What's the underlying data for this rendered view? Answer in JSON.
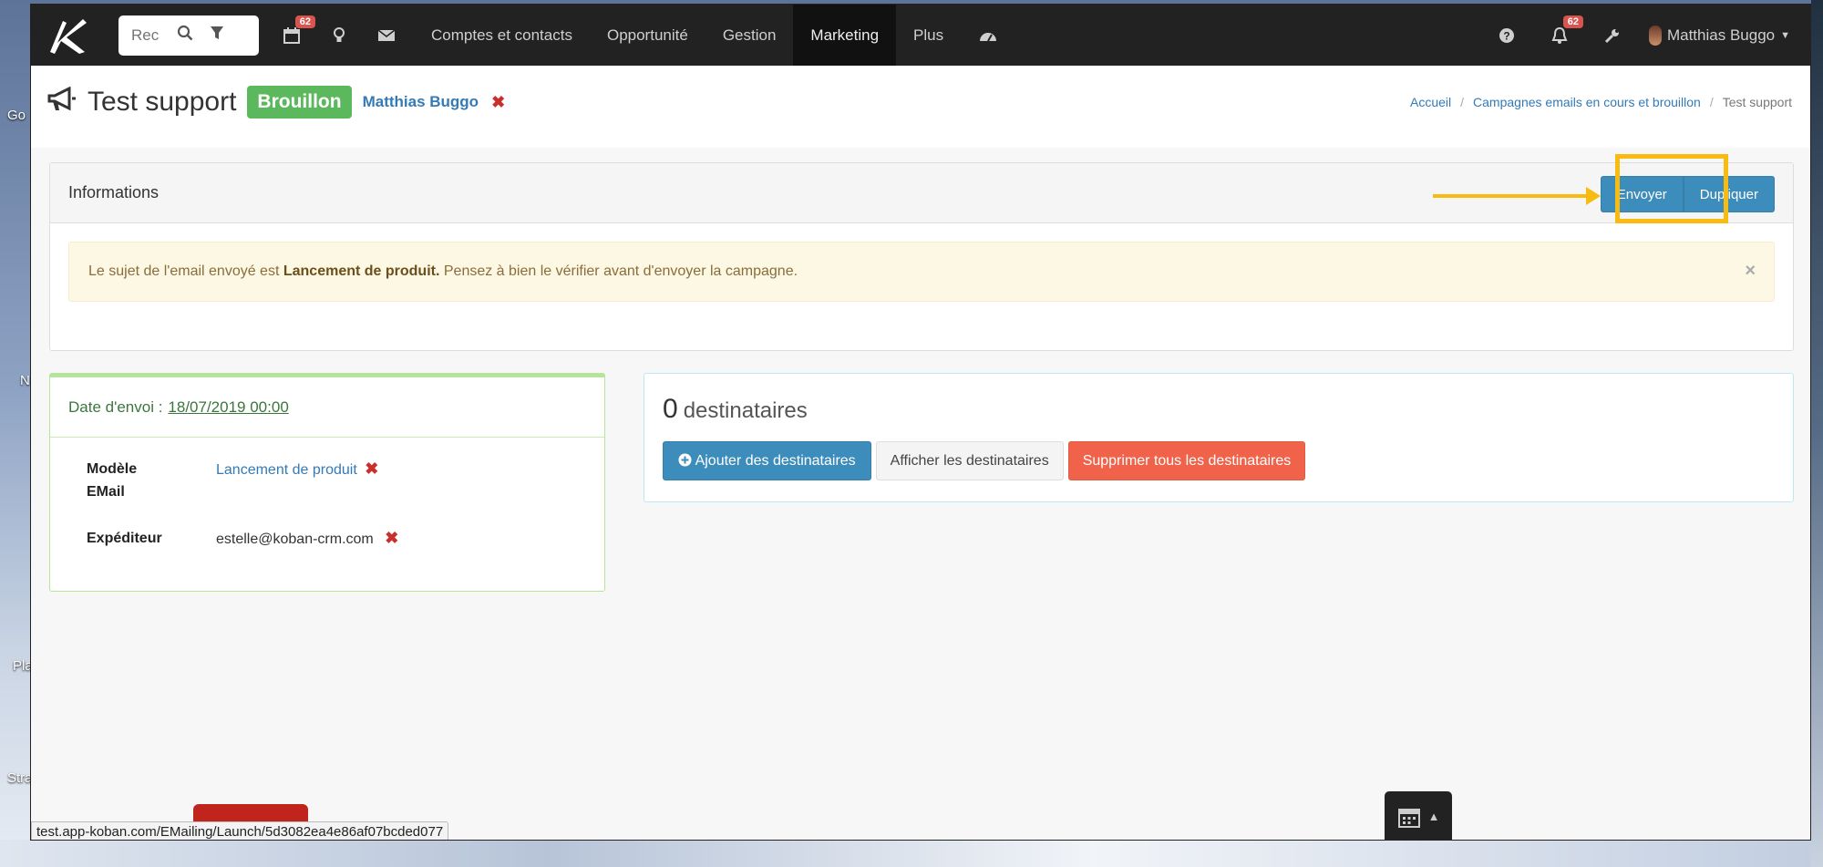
{
  "desktop": {
    "labels": [
      "Go",
      "N",
      "Pla",
      "Stra"
    ]
  },
  "nav": {
    "search_placeholder": "Rec",
    "calendar_badge": "62",
    "links": [
      "Comptes et contacts",
      "Opportunité",
      "Gestion",
      "Marketing",
      "Plus"
    ],
    "active_link": "Marketing",
    "notif_badge": "62",
    "user_name": "Matthias Buggo"
  },
  "header": {
    "title": "Test support",
    "status": "Brouillon",
    "owner": "Matthias Buggo",
    "breadcrumb": [
      "Accueil",
      "Campagnes emails en cours et brouillon",
      "Test support"
    ]
  },
  "info_panel": {
    "heading": "Informations",
    "send_button": "Envoyer",
    "duplicate_button": "Dupliquer",
    "alert_prefix": "Le sujet de l'email envoyé est ",
    "alert_subject": "Lancement de produit.",
    "alert_suffix": " Pensez à bien le vérifier avant d'envoyer la campagne.",
    "alert_close": "×"
  },
  "date_panel": {
    "label": "Date d'envoi :",
    "date": "18/07/2019 00:00",
    "rows": [
      {
        "key_line1": "Modèle",
        "key_line2": "EMail",
        "value": "Lancement de produit"
      },
      {
        "key_line1": "Expéditeur",
        "value": "estelle@koban-crm.com"
      }
    ]
  },
  "dest_panel": {
    "count": "0",
    "count_label": "destinataires",
    "add_button": "Ajouter des destinataires",
    "show_button": "Afficher les destinataires",
    "delete_button": "Supprimer tous les destinataires"
  },
  "status_bar": {
    "url": "test.app-koban.com/EMailing/Launch/5d3082ea4e86af07bcded077"
  },
  "colors": {
    "nav_bg": "#222222",
    "status_green": "#5cb85c",
    "primary_blue": "#3c8dbc",
    "danger": "#f0624a",
    "highlight": "#f7bb12"
  }
}
